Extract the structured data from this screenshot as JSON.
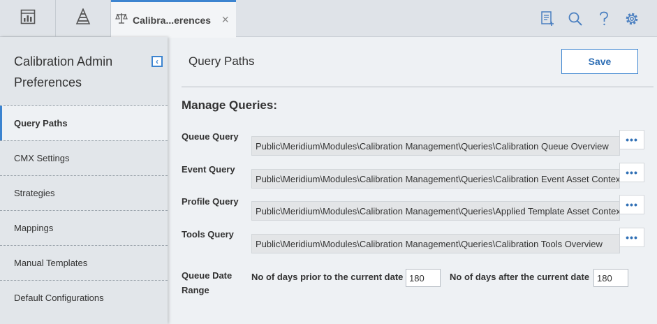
{
  "topbar": {
    "tab_label": "Calibra...erences",
    "close_glyph": "×",
    "icons": [
      "dashboard-icon",
      "asset-hierarchy-icon",
      "scales-icon",
      "new-document-icon",
      "search-icon",
      "help-icon",
      "settings-icon"
    ],
    "accent": "#3c84d0"
  },
  "sidebar": {
    "title": "Calibration Admin Preferences",
    "collapse_glyph": "‹",
    "items": [
      {
        "label": "Query Paths",
        "active": true
      },
      {
        "label": "CMX Settings"
      },
      {
        "label": "Strategies"
      },
      {
        "label": "Mappings"
      },
      {
        "label": "Manual Templates"
      },
      {
        "label": "Default Configurations"
      }
    ]
  },
  "main": {
    "title": "Query Paths",
    "save_label": "Save",
    "section_title": "Manage Queries:",
    "more_label": "•••",
    "queries": [
      {
        "label": "Queue Query",
        "value": "Public\\Meridium\\Modules\\Calibration Management\\Queries\\Calibration Queue Overview"
      },
      {
        "label": "Event Query",
        "value": "Public\\Meridium\\Modules\\Calibration Management\\Queries\\Calibration Event Asset Context"
      },
      {
        "label": "Profile Query",
        "value": "Public\\Meridium\\Modules\\Calibration Management\\Queries\\Applied Template Asset Context"
      },
      {
        "label": "Tools Query",
        "value": "Public\\Meridium\\Modules\\Calibration Management\\Queries\\Calibration Tools Overview"
      }
    ],
    "date_range": {
      "label": "Queue Date Range",
      "prior_label": "No of days prior to the current date",
      "prior_value": "180",
      "after_label": "No of days after the current date",
      "after_value": "180"
    }
  }
}
